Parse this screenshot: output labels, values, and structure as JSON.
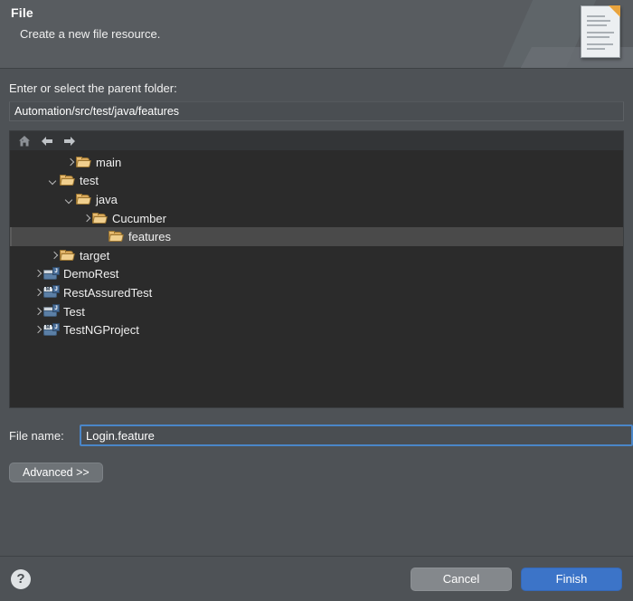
{
  "header": {
    "title": "File",
    "subtitle": "Create a new file resource.",
    "icon": "file-document-icon"
  },
  "parent_folder": {
    "label": "Enter or select the parent folder:",
    "value": "Automation/src/test/java/features"
  },
  "tree_toolbar": {
    "home_icon": "home-icon",
    "back_icon": "back-arrow-icon",
    "forward_icon": "forward-arrow-icon"
  },
  "tree": {
    "rows": [
      {
        "label": "main",
        "indent": 3,
        "twisty": "right",
        "icon": "folder-icon",
        "badge": "",
        "selected": false
      },
      {
        "label": "test",
        "indent": 2,
        "twisty": "down",
        "icon": "folder-icon",
        "badge": "",
        "selected": false
      },
      {
        "label": "java",
        "indent": 3,
        "twisty": "down",
        "icon": "folder-icon",
        "badge": "",
        "selected": false
      },
      {
        "label": "Cucumber",
        "indent": 4,
        "twisty": "right",
        "icon": "folder-icon",
        "badge": "",
        "selected": false
      },
      {
        "label": "features",
        "indent": 5,
        "twisty": "none",
        "icon": "folder-icon",
        "badge": "",
        "selected": true
      },
      {
        "label": "target",
        "indent": 2,
        "twisty": "right",
        "icon": "folder-icon",
        "badge": "",
        "selected": false
      },
      {
        "label": "DemoRest",
        "indent": 1,
        "twisty": "right",
        "icon": "project-icon",
        "badge": "",
        "selected": false
      },
      {
        "label": "RestAssuredTest",
        "indent": 1,
        "twisty": "right",
        "icon": "project-icon",
        "badge": "M",
        "selected": false
      },
      {
        "label": "Test",
        "indent": 1,
        "twisty": "right",
        "icon": "project-icon",
        "badge": "",
        "selected": false
      },
      {
        "label": "TestNGProject",
        "indent": 1,
        "twisty": "right",
        "icon": "project-icon",
        "badge": "M",
        "selected": false
      }
    ]
  },
  "file_name": {
    "label": "File name:",
    "value": "Login.feature"
  },
  "advanced": {
    "label": "Advanced >>"
  },
  "footer": {
    "help_icon": "help-question-icon",
    "cancel_label": "Cancel",
    "finish_label": "Finish"
  },
  "colors": {
    "dialog_bg": "#4e5256",
    "header_bg": "#585c60",
    "tree_bg": "#2b2b2b",
    "selection_bg": "#4a4a4a",
    "focus_border": "#4a86c8",
    "finish_bg": "#3c74c8",
    "folder_gold": "#f0cf8e"
  }
}
